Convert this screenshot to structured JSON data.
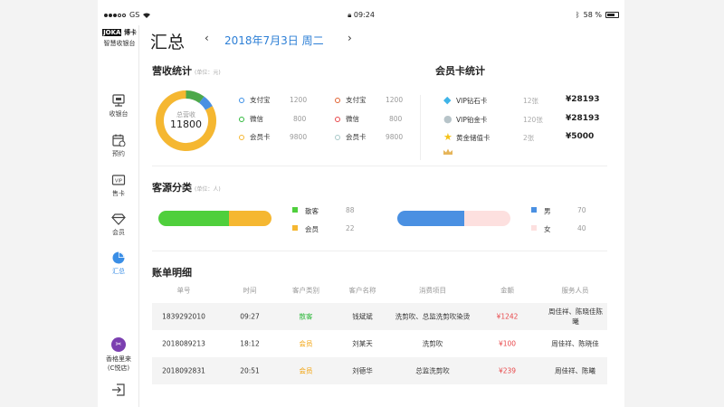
{
  "status_bar": {
    "carrier": "GS",
    "time": "09:24",
    "battery": "58 %",
    "battery_level": 0.58
  },
  "brand": {
    "logo_text": "JOKA",
    "logo_cn": "博卡",
    "app_name": "智慧收银台"
  },
  "sidebar": {
    "items": [
      {
        "label": "收银台",
        "icon": "cash-register-icon"
      },
      {
        "label": "预约",
        "icon": "calendar-icon"
      },
      {
        "label": "售卡",
        "icon": "vip-card-icon"
      },
      {
        "label": "会员",
        "icon": "diamond-icon"
      },
      {
        "label": "汇总",
        "icon": "pie-chart-icon",
        "active": true
      }
    ],
    "store_name": "香格里来",
    "store_sub": "(C悦店)"
  },
  "header": {
    "title": "汇总",
    "prev": "‹",
    "date": "2018年7月3日 周二",
    "next": "›"
  },
  "revenue": {
    "title": "营收统计",
    "unit": "(单位：元)",
    "donut_label": "总营收",
    "donut_value": "11800",
    "donut_slices": [
      {
        "name": "支付宝",
        "value": 1200,
        "color": "#4ca84a"
      },
      {
        "name": "微信",
        "value": 800,
        "color": "#4a90e2"
      },
      {
        "name": "会员卡",
        "value": 9800,
        "color": "#f5b731"
      }
    ],
    "col1": [
      {
        "label": "支付宝",
        "value": "1200",
        "color": "#3a8ee6"
      },
      {
        "label": "微信",
        "value": "800",
        "color": "#2fb83c"
      },
      {
        "label": "会员卡",
        "value": "9800",
        "color": "#f5b731"
      }
    ],
    "col2": [
      {
        "label": "支付宝",
        "value": "1200",
        "color": "#e0612f"
      },
      {
        "label": "微信",
        "value": "800",
        "color": "#e8474a"
      },
      {
        "label": "会员卡",
        "value": "9800",
        "color": "#a8c8c8"
      }
    ]
  },
  "member_cards": {
    "title": "会员卡统计",
    "rows": [
      {
        "name": "VIP钻石卡",
        "count": "12张",
        "amount": "¥28193",
        "icon": "diamond-icon"
      },
      {
        "name": "VIP铂金卡",
        "count": "120张",
        "amount": "¥28193",
        "icon": "platinum-icon"
      },
      {
        "name": "黄金储值卡",
        "count": "2张",
        "amount": "¥5000",
        "icon": "gold-star-icon"
      }
    ],
    "extra_icon": "crown-icon"
  },
  "customer_source": {
    "title": "客源分类",
    "unit": "(单位：人)",
    "type_legend": [
      {
        "label": "散客",
        "value": "88",
        "color": "#4fcf3c"
      },
      {
        "label": "会员",
        "value": "22",
        "color": "#f5b731"
      }
    ],
    "type_share": [
      0.62,
      0.38
    ],
    "gender_legend": [
      {
        "label": "男",
        "value": "70",
        "color": "#4a90e2"
      },
      {
        "label": "女",
        "value": "40",
        "color": "#fde0df"
      }
    ],
    "gender_share": [
      0.59,
      0.41
    ]
  },
  "bills": {
    "title": "账单明细",
    "headers": [
      "单号",
      "时间",
      "客户类别",
      "客户名称",
      "消费项目",
      "金额",
      "服务人员"
    ],
    "rows": [
      {
        "id": "1839292010",
        "time": "09:27",
        "type": "散客",
        "type_color": "green",
        "name": "钱斌斌",
        "items": "洗剪吹、总监洗剪吹染烫",
        "amount": "¥1242",
        "staff": "周佳祥、陈晓佳陈曦"
      },
      {
        "id": "2018089213",
        "time": "18:12",
        "type": "会员",
        "type_color": "orange",
        "name": "刘某天",
        "items": "洗剪吹",
        "amount": "¥100",
        "staff": "周佳祥、陈晓佳"
      },
      {
        "id": "2018092831",
        "time": "20:51",
        "type": "会员",
        "type_color": "orange",
        "name": "刘德华",
        "items": "总监洗剪吹",
        "amount": "¥239",
        "staff": "周佳祥、陈曦"
      }
    ]
  }
}
